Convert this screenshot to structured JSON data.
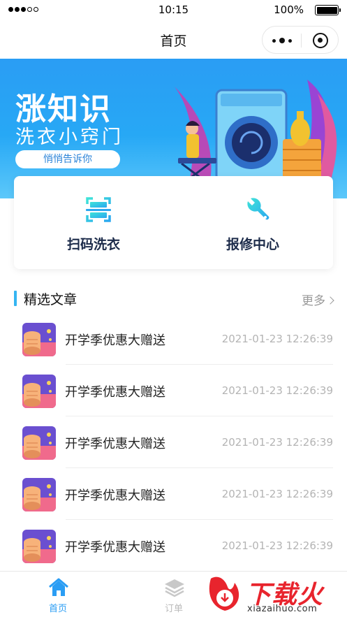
{
  "status_bar": {
    "time": "10:15",
    "battery": "100%"
  },
  "nav": {
    "title": "首页"
  },
  "banner": {
    "title": "涨知识",
    "subtitle": "洗衣小窍门",
    "pill": "悄悄告诉你"
  },
  "services": [
    {
      "label": "扫码洗衣",
      "icon": "scan-icon"
    },
    {
      "label": "报修中心",
      "icon": "wrench-icon"
    }
  ],
  "section": {
    "title": "精选文章",
    "more": "更多"
  },
  "articles": [
    {
      "title": "开学季优惠大赠送",
      "date": "2021-01-23 12:26:39"
    },
    {
      "title": "开学季优惠大赠送",
      "date": "2021-01-23 12:26:39"
    },
    {
      "title": "开学季优惠大赠送",
      "date": "2021-01-23 12:26:39"
    },
    {
      "title": "开学季优惠大赠送",
      "date": "2021-01-23 12:26:39"
    },
    {
      "title": "开学季优惠大赠送",
      "date": "2021-01-23 12:26:39"
    }
  ],
  "tabs": [
    {
      "label": "首页",
      "icon": "home-icon",
      "active": true
    },
    {
      "label": "订单",
      "icon": "layers-icon",
      "active": false
    }
  ],
  "watermark": {
    "brand": "下载火",
    "url": "xiazaihuo.com"
  },
  "colors": {
    "accent": "#2a9df4",
    "section_bar": "#35b5f2",
    "watermark": "#e8242d"
  }
}
